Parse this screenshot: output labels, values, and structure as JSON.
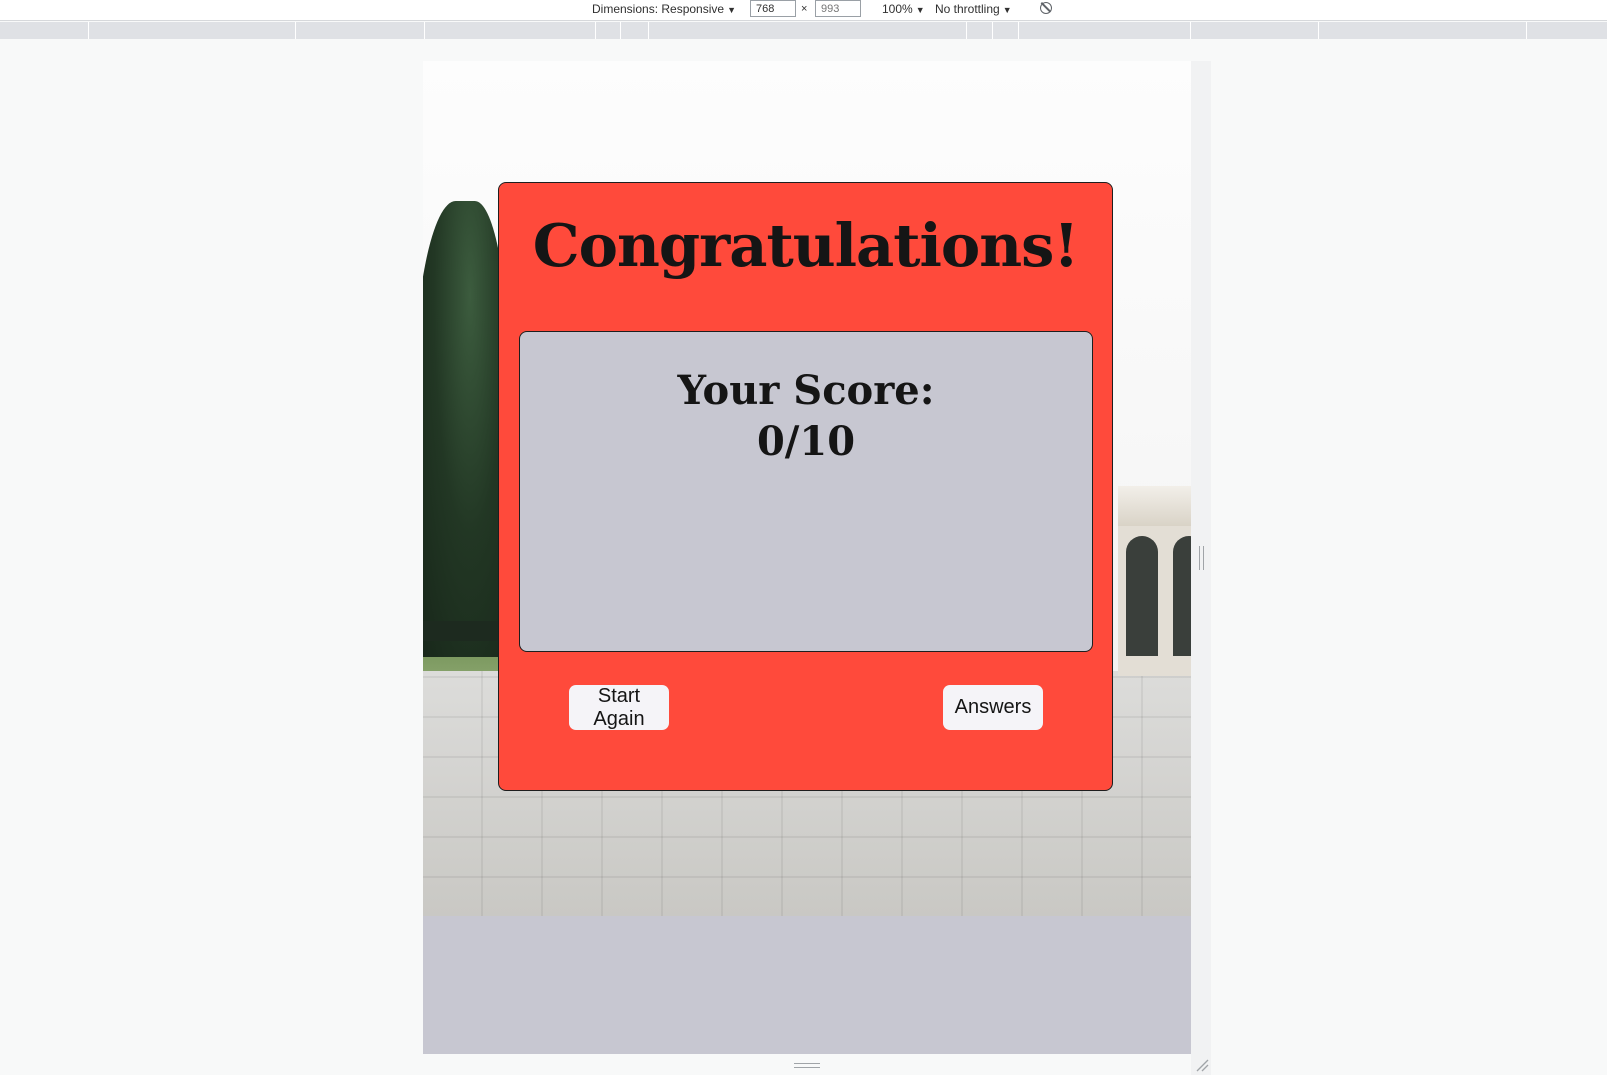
{
  "devtools": {
    "dimensions_label": "Dimensions: Responsive",
    "width_value": "768",
    "times_sign": "×",
    "height_placeholder": "993",
    "zoom_label": "100%",
    "throttling_label": "No throttling",
    "caret": "▼"
  },
  "quiz_result": {
    "title": "Congratulations!",
    "score_label": "Your Score:",
    "score_value": "0/10",
    "start_again_label": "Start Again",
    "answers_label": "Answers"
  },
  "colors": {
    "modal_background": "#ff4a3b",
    "score_panel_background": "#c7c7d1",
    "button_background": "#f5f4f8",
    "page_background": "#c7c7d1"
  },
  "icons": [
    "rotate-icon",
    "resize-handle-icon"
  ]
}
